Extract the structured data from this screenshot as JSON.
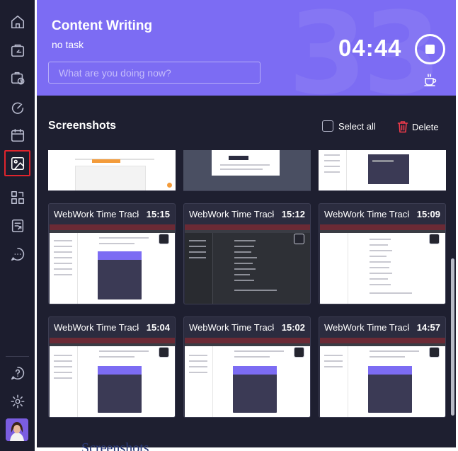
{
  "sidebar": {
    "items": [
      {
        "name": "home-icon"
      },
      {
        "name": "task-icon"
      },
      {
        "name": "time-icon"
      },
      {
        "name": "speedometer-icon"
      },
      {
        "name": "calendar-icon"
      },
      {
        "name": "screenshots-icon",
        "active": true
      },
      {
        "name": "apps-icon"
      },
      {
        "name": "report-icon"
      },
      {
        "name": "chat-icon"
      }
    ],
    "bottom": [
      {
        "name": "help-icon"
      },
      {
        "name": "gear-icon"
      }
    ]
  },
  "header": {
    "title": "Content Writing",
    "subtitle": "no task",
    "input_placeholder": "What are you doing now?",
    "bg_number": "33",
    "timer": "04:44",
    "accent": "#7c6cf3"
  },
  "toolbar": {
    "title": "Screenshots",
    "select_all": "Select all",
    "delete": "Delete"
  },
  "screenshots": [
    {
      "name": "WebWork Time Tracker",
      "time": "15:15",
      "theme": "light"
    },
    {
      "name": "WebWork Time Tracker",
      "time": "15:12",
      "theme": "dark"
    },
    {
      "name": "WebWork Time Tracker",
      "time": "15:09",
      "theme": "light"
    },
    {
      "name": "WebWork Time Tracker",
      "time": "15:04",
      "theme": "light"
    },
    {
      "name": "WebWork Time Tracker",
      "time": "15:02",
      "theme": "light"
    },
    {
      "name": "WebWork Time Tracker",
      "time": "14:57",
      "theme": "light"
    }
  ],
  "below_text": "Screenshots"
}
